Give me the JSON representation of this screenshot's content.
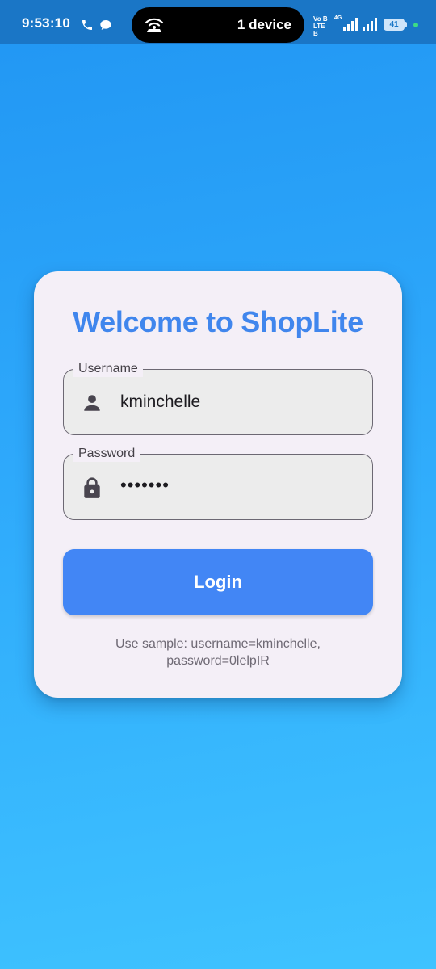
{
  "status_bar": {
    "time": "9:53:10",
    "hotspot_text": "1 device",
    "volte_label": "Vo B LTE B",
    "network_label": "4G",
    "battery_level": "41",
    "icons": [
      "phone-icon",
      "chat-bubble-icon",
      "hotspot-icon",
      "signal-icon",
      "battery-icon"
    ],
    "dot_color": "#3ddc84"
  },
  "login": {
    "title": "Welcome to ShopLite",
    "username": {
      "label": "Username",
      "value": "kminchelle",
      "icon": "person-icon"
    },
    "password": {
      "label": "Password",
      "value": "0lelpIR",
      "icon": "lock-icon"
    },
    "button_label": "Login",
    "hint": "Use sample: username=kminchelle, password=0lelpIR"
  },
  "colors": {
    "title": "#4086ed",
    "button": "#4286f5",
    "card_background": "#f4eff7",
    "background_top": "#2196f3",
    "background_bottom": "#3fc3ff"
  }
}
